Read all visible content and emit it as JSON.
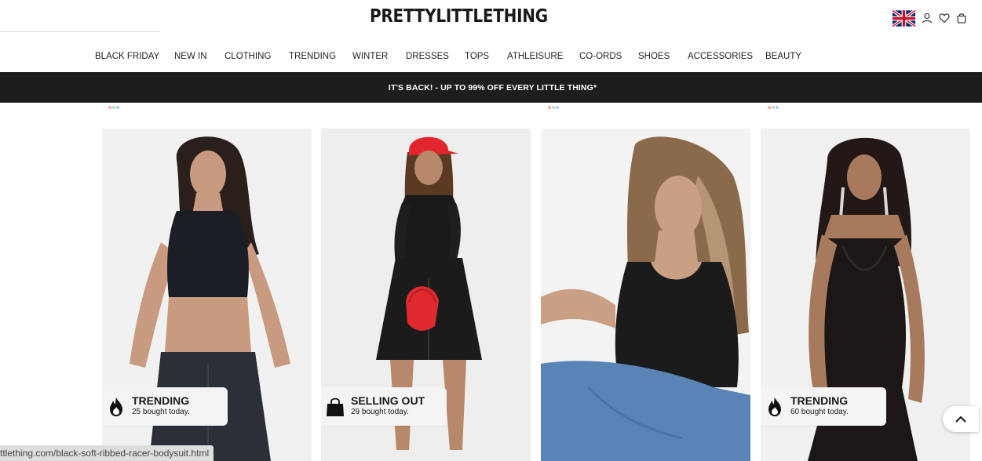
{
  "header": {
    "logo": "PRETTYLITTLETHING",
    "icons": [
      "uk-flag-icon",
      "account-icon",
      "wishlist-heart-icon",
      "bag-icon"
    ]
  },
  "nav": {
    "items": [
      "BLACK FRIDAY",
      "NEW IN",
      "CLOTHING",
      "TRENDING",
      "WINTER",
      "DRESSES",
      "TOPS",
      "ATHLEISURE",
      "CO-ORDS",
      "SHOES",
      "ACCESSORIES",
      "BEAUTY"
    ]
  },
  "promo": {
    "text": "IT'S BACK! - UP TO 99% OFF EVERY LITTLE THING*"
  },
  "products": [
    {
      "badge_title": "TRENDING",
      "badge_sub": "25 bought today.",
      "badge_icon": "flame-icon"
    },
    {
      "badge_title": "SELLING OUT",
      "badge_sub": "29 bought today.",
      "badge_icon": "shopping-bag-icon"
    },
    {
      "badge_title": "",
      "badge_sub": "",
      "badge_icon": ""
    },
    {
      "badge_title": "TRENDING",
      "badge_sub": "60 bought today.",
      "badge_icon": "flame-icon"
    }
  ],
  "colors": {
    "promo_bg": "#1d1d1d",
    "swatch_colors": [
      "#f7a8b8",
      "#b8e3a8",
      "#a8c8f7"
    ]
  },
  "status_bar": {
    "url": "ttlething.com/black-soft-ribbed-racer-bodysuit.html"
  }
}
